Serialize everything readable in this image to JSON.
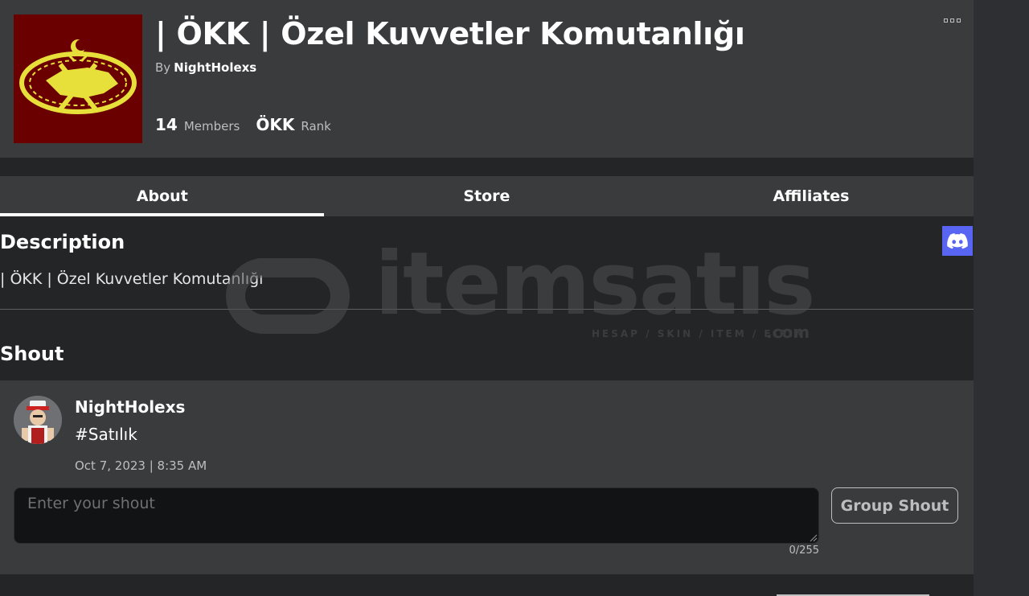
{
  "group": {
    "title": "| ÖKK | Özel Kuvvetler Komutanlığı",
    "by_prefix": "By",
    "owner": "NightHolexs",
    "members_count": "14",
    "members_label": "Members",
    "rank_value": "ÖKK",
    "rank_label": "Rank",
    "emblem_icon": "military-emblem-icon",
    "emblem_bg": "#6b0000",
    "emblem_fg": "#e8e03a"
  },
  "tabs": [
    {
      "label": "About",
      "active": true
    },
    {
      "label": "Store",
      "active": false
    },
    {
      "label": "Affiliates",
      "active": false
    }
  ],
  "description": {
    "heading": "Description",
    "text": "| ÖKK | Özel Kuvvetler Komutanlığı",
    "social_icon": "discord-icon",
    "social_color": "#5865f2"
  },
  "shout": {
    "heading": "Shout",
    "poster": "NightHolexs",
    "body": "#Satılık",
    "date": "Oct 7, 2023 | 8:35 AM",
    "input_placeholder": "Enter your shout",
    "char_count": "0/255",
    "button_label": "Group Shout"
  },
  "watermark": {
    "brand": "itemsatıs",
    "tagline": "HESAP / SKIN / ITEM / E-PIN",
    "suffix": ".com"
  }
}
